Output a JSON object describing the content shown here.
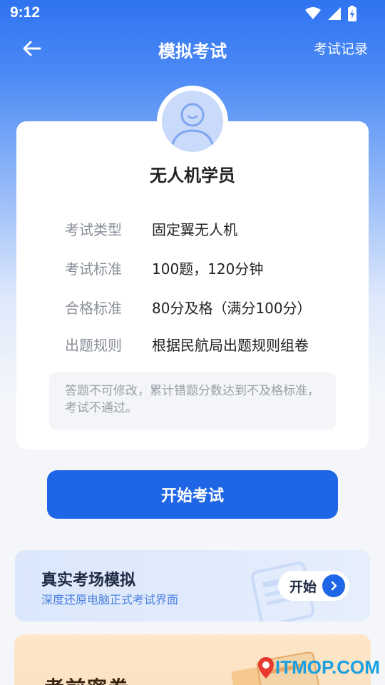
{
  "status_bar": {
    "time": "9:12"
  },
  "nav": {
    "title": "模拟考试",
    "right_link": "考试记录"
  },
  "profile": {
    "name": "无人机学员"
  },
  "exam_info": [
    {
      "label": "考试类型",
      "value": "固定翼无人机"
    },
    {
      "label": "考试标准",
      "value": "100题，120分钟"
    },
    {
      "label": "合格标准",
      "value": "80分及格（满分100分）"
    },
    {
      "label": "出题规则",
      "value": "根据民航局出题规则组卷"
    }
  ],
  "notice": "答题不可修改，累计错题分数达到不及格标准，考试不通过。",
  "start_button": "开始考试",
  "real_exam": {
    "title": "真实考场模拟",
    "subtitle": "深度还原电脑正式考试界面",
    "button": "开始"
  },
  "bottom_card": {
    "title": "考前密卷"
  },
  "watermark": {
    "text": "ITMOP.COM"
  },
  "colors": {
    "primary": "#1f66e6",
    "header_blue": "#2f73f0",
    "accent_orange": "#fbe1c1"
  }
}
